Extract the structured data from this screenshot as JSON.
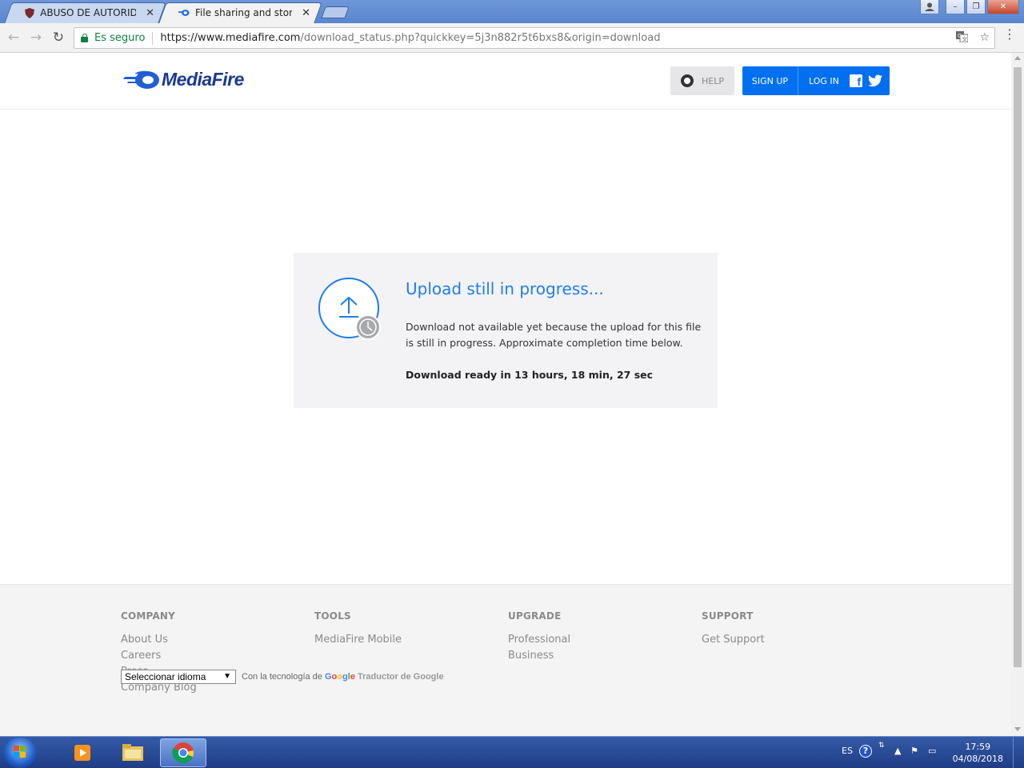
{
  "browser": {
    "tabs": [
      {
        "title": "ABUSO DE AUTORIDAD",
        "close": "✕",
        "active": false
      },
      {
        "title": "File sharing and storage made",
        "close": "✕",
        "active": true
      }
    ],
    "nav": {
      "back": "←",
      "forward": "→",
      "reload": "↻"
    },
    "omnibox": {
      "secure_label": "Es seguro",
      "url_host": "https://www.mediafire.com",
      "url_path": "/download_status.php?quickkey=5j3n882r5t6bxs8&origin=download"
    },
    "icons": {
      "translate": "translate-icon",
      "star": "☆",
      "menu": "⋮"
    },
    "window_controls": {
      "profile": "person-icon",
      "minimize": "–",
      "restore": "❐",
      "close": "✕"
    }
  },
  "header": {
    "logo_text": "MediaFire",
    "help_label": "HELP",
    "signup_label": "SIGN UP",
    "login_label": "LOG IN",
    "facebook_glyph": "f",
    "brand_color": "#0070f0"
  },
  "status": {
    "title": "Upload still in progress...",
    "description": "Download not available yet because the upload for this file is still in progress. Approximate completion time below.",
    "eta": "Download ready in 13 hours, 18 min, 27 sec",
    "title_color": "#1f7ee8"
  },
  "footer": {
    "columns": [
      {
        "heading": "COMPANY",
        "links": [
          "About Us",
          "Careers",
          "Press",
          "Company Blog"
        ]
      },
      {
        "heading": "TOOLS",
        "links": [
          "MediaFire Mobile"
        ]
      },
      {
        "heading": "UPGRADE",
        "links": [
          "Professional",
          "Business"
        ]
      },
      {
        "heading": "SUPPORT",
        "links": [
          "Get Support"
        ]
      }
    ],
    "language_select": "Seleccionar idioma",
    "powered_prefix": "Con la tecnología de",
    "powered_google": [
      "G",
      "o",
      "o",
      "g",
      "l",
      "e"
    ],
    "powered_suffix": "Traductor de Google"
  },
  "taskbar": {
    "language": "ES",
    "help_glyph": "?",
    "time": "17:59",
    "date": "04/08/2018"
  }
}
